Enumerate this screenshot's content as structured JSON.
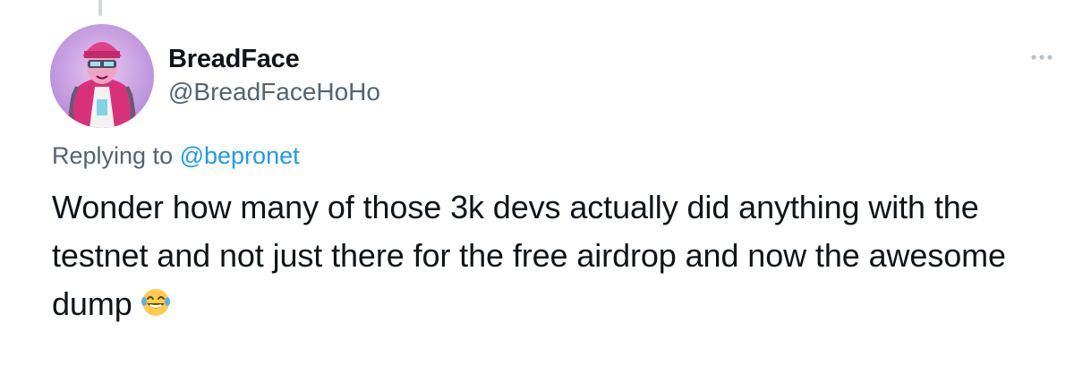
{
  "tweet": {
    "author": {
      "display_name": "BreadFace",
      "handle": "@BreadFaceHoHo",
      "avatar_icon": "avatar-pink-character-icon"
    },
    "reply": {
      "prefix": "Replying to",
      "mention": "@bepronet"
    },
    "text": "Wonder how many of those 3k devs actually did anything with the testnet and not just there for the free airdrop and now the awesome dump",
    "emoji_icon": "laughing-crying-emoji-icon",
    "more_icon": "more-options-icon"
  },
  "colors": {
    "text_primary": "#0f1419",
    "text_secondary": "#536471",
    "accent": "#1d9bf0",
    "thread_line": "#cfd9de"
  }
}
